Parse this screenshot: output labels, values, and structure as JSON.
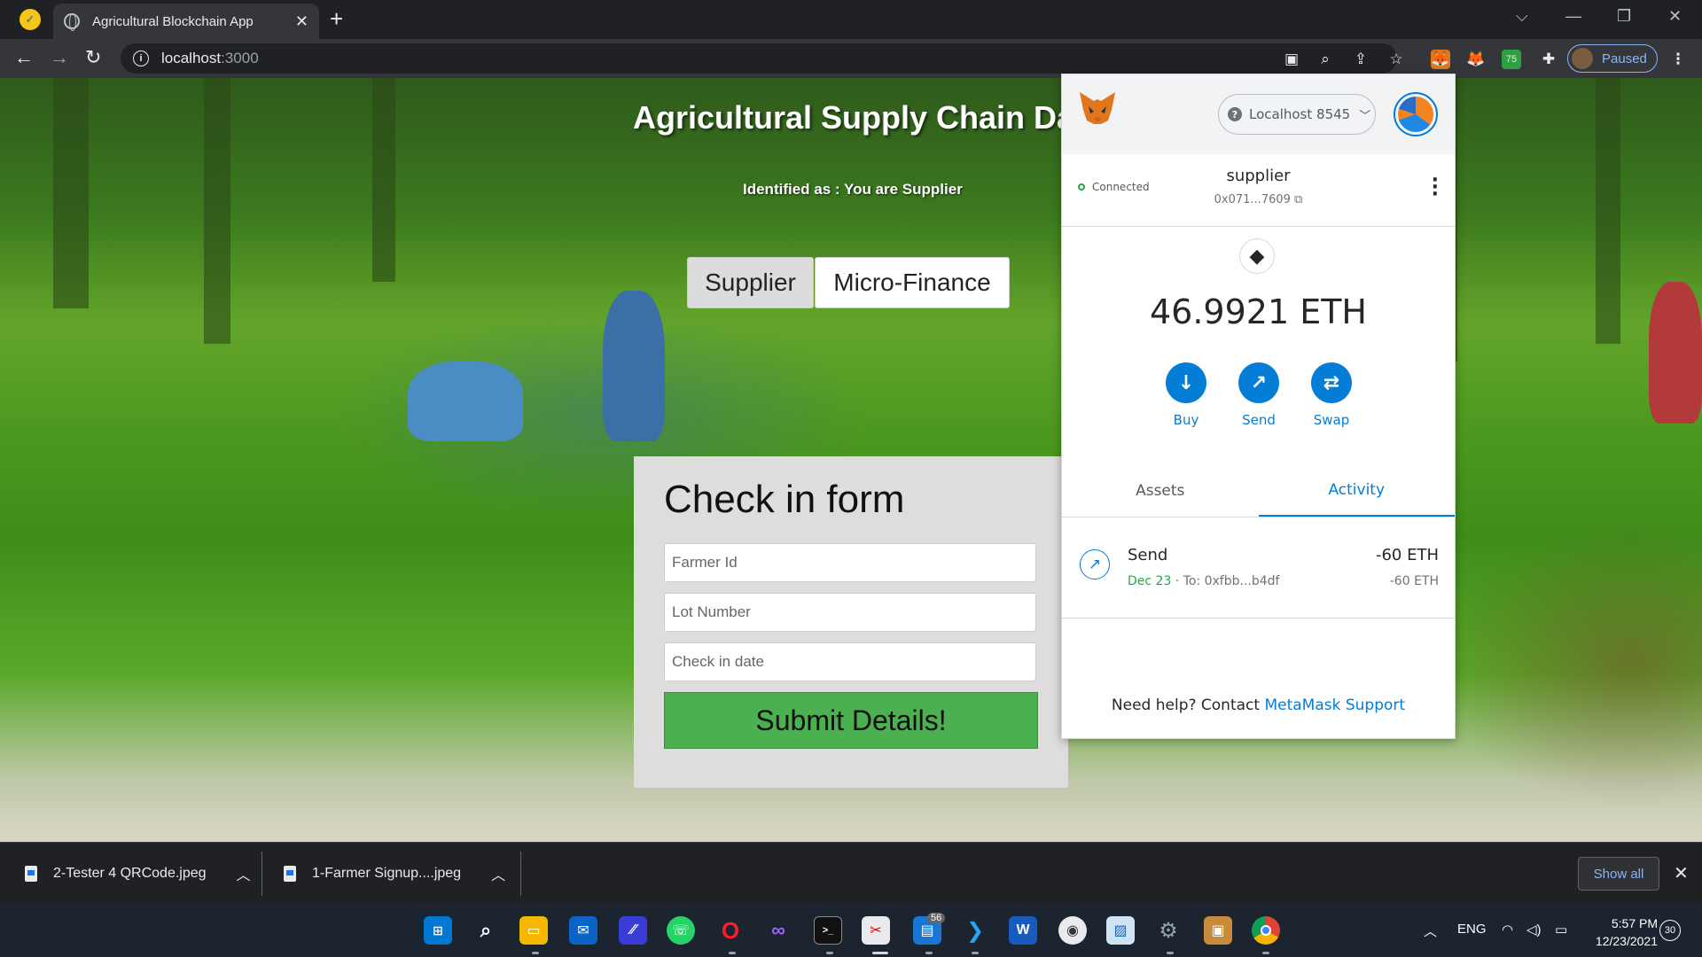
{
  "browser": {
    "tab_title": "Agricultural Blockchain App",
    "url_host": "localhost",
    "url_port": ":3000",
    "profile_status": "Paused"
  },
  "page": {
    "title": "Agricultural Supply Chain Dapp",
    "identified_as": "Identified as : You are Supplier",
    "roles": [
      "Supplier",
      "Micro-Finance"
    ],
    "form": {
      "heading": "Check in form",
      "farmer_id_placeholder": "Farmer Id",
      "lot_number_placeholder": "Lot Number",
      "checkin_date_placeholder": "Check in date",
      "submit_label": "Submit Details!"
    }
  },
  "metamask": {
    "network": "Localhost 8545",
    "connection_status": "Connected",
    "account_name": "supplier",
    "account_address": "0x071...7609",
    "balance": "46.9921 ETH",
    "actions": [
      "Buy",
      "Send",
      "Swap"
    ],
    "tabs": [
      "Assets",
      "Activity"
    ],
    "active_tab": "Activity",
    "transaction": {
      "type": "Send",
      "date": "Dec 23",
      "to": " · To: 0xfbb...b4df",
      "amount": "-60 ETH",
      "amount_secondary": "-60 ETH"
    },
    "help_text": "Need help? Contact ",
    "help_link": "MetaMask Support"
  },
  "downloads": [
    {
      "name": "2-Tester 4 QRCode.jpeg"
    },
    {
      "name": "1-Farmer Signup....jpeg"
    }
  ],
  "downloads_show_all": "Show all",
  "taskbar": {
    "language": "ENG",
    "time": "5:57 PM",
    "date": "12/23/2021",
    "notification_count": "30",
    "badge_count": "56"
  },
  "colors": {
    "metamask_blue": "#037dd6",
    "submit_green": "#4caf50",
    "connected_green": "#28a745"
  }
}
